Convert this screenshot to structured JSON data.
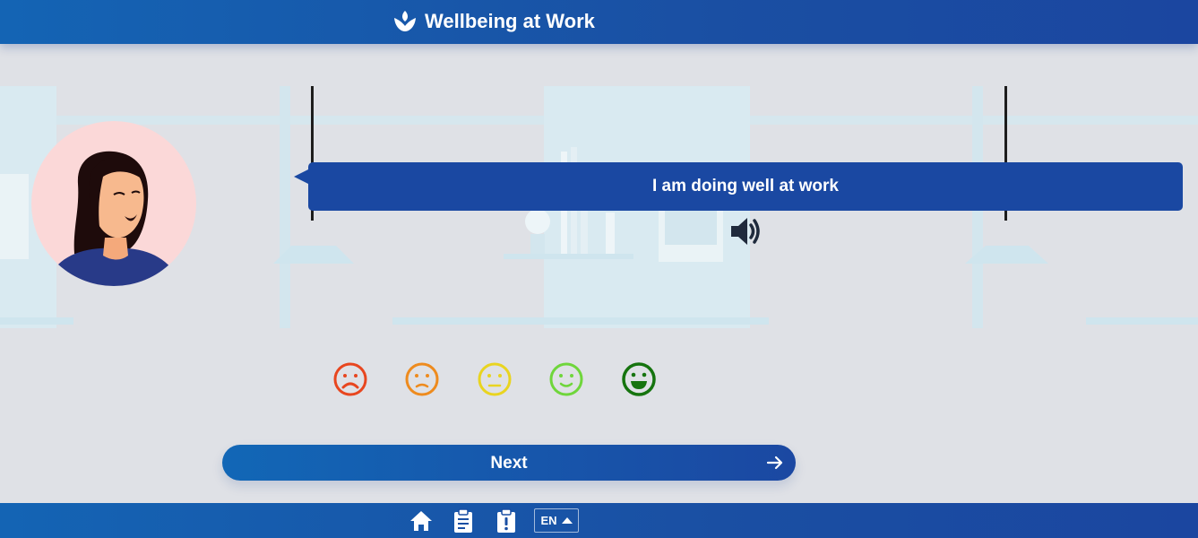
{
  "header": {
    "title": "Wellbeing at Work",
    "logo_icon": "lotus-icon"
  },
  "question": {
    "text": "I am doing well at work",
    "audio_icon": "speaker-icon"
  },
  "rating": {
    "options": [
      {
        "name": "very-sad-face-icon",
        "color": "#e8461f"
      },
      {
        "name": "sad-face-icon",
        "color": "#ee8b1e"
      },
      {
        "name": "neutral-face-icon",
        "color": "#e9d420"
      },
      {
        "name": "happy-face-icon",
        "color": "#6fd63b"
      },
      {
        "name": "very-happy-face-icon",
        "color": "#16740f"
      }
    ]
  },
  "next_button": {
    "label": "Next",
    "icon": "arrow-right-icon"
  },
  "footer": {
    "icons": [
      "home-icon",
      "clipboard-icon",
      "alert-icon"
    ],
    "language": "EN"
  },
  "colors": {
    "primary": "#1a48a2",
    "background": "#dfe1e6",
    "avatar_bg": "#fbd8d8"
  }
}
